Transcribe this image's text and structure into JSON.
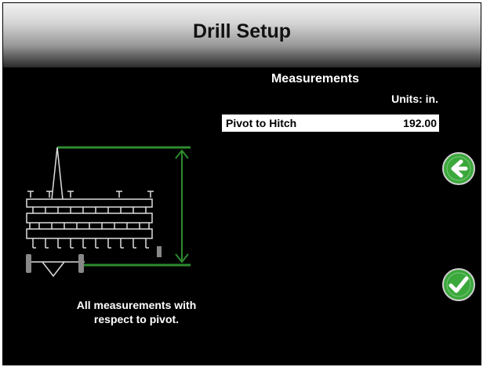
{
  "header": {
    "title": "Drill Setup"
  },
  "measurements": {
    "section_title": "Measurements",
    "units_label": "Units: in.",
    "rows": [
      {
        "label": "Pivot to Hitch",
        "value": "192.00"
      }
    ]
  },
  "note": {
    "line1": "All measurements with",
    "line2": "respect to pivot."
  },
  "buttons": {
    "back_icon": "arrow-left-icon",
    "confirm_icon": "checkmark-icon"
  },
  "colors": {
    "accent_green": "#2e8b2e",
    "button_green": "#3aa83a",
    "background": "#000000"
  }
}
